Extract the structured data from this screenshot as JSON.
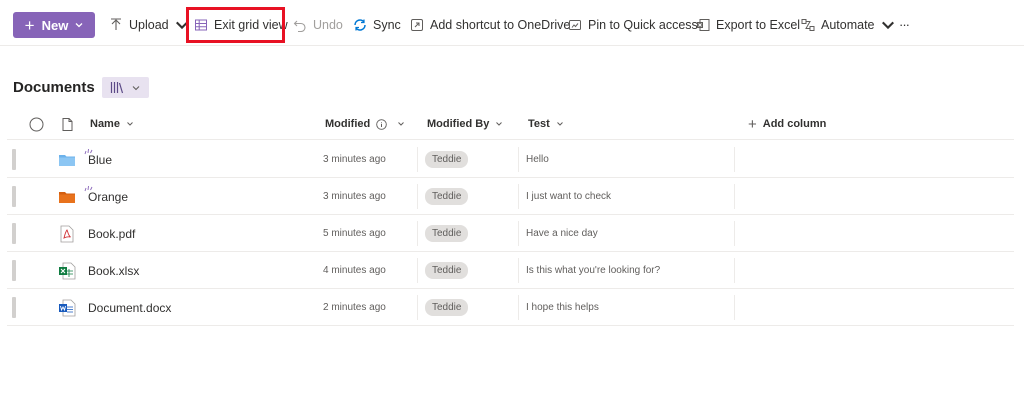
{
  "toolbar": {
    "new_label": "New",
    "upload_label": "Upload",
    "exit_grid_label": "Exit grid view",
    "undo_label": "Undo",
    "sync_label": "Sync",
    "shortcut_label": "Add shortcut to OneDrive",
    "pin_label": "Pin to Quick access",
    "export_label": "Export to Excel",
    "automate_label": "Automate",
    "more_label": "···",
    "accent_color": "#8764b8",
    "highlight_color": "#e81123"
  },
  "library": {
    "title": "Documents"
  },
  "columns": {
    "name": "Name",
    "modified": "Modified",
    "modified_by": "Modified By",
    "test": "Test",
    "add_column": "Add column"
  },
  "files": [
    {
      "name": "Blue",
      "type": "folder-blue",
      "modified": "3 minutes ago",
      "modified_by": "Teddie",
      "test": "Hello",
      "is_new": true
    },
    {
      "name": "Orange",
      "type": "folder-orange",
      "modified": "3 minutes ago",
      "modified_by": "Teddie",
      "test": "I just want to check",
      "is_new": true
    },
    {
      "name": "Book.pdf",
      "type": "pdf",
      "modified": "5 minutes ago",
      "modified_by": "Teddie",
      "test": "Have a nice day",
      "is_new": false
    },
    {
      "name": "Book.xlsx",
      "type": "excel",
      "modified": "4 minutes ago",
      "modified_by": "Teddie",
      "test": "Is this what you're looking for?",
      "is_new": false
    },
    {
      "name": "Document.docx",
      "type": "word",
      "modified": "2 minutes ago",
      "modified_by": "Teddie",
      "test": "I hope this helps",
      "is_new": false
    }
  ]
}
